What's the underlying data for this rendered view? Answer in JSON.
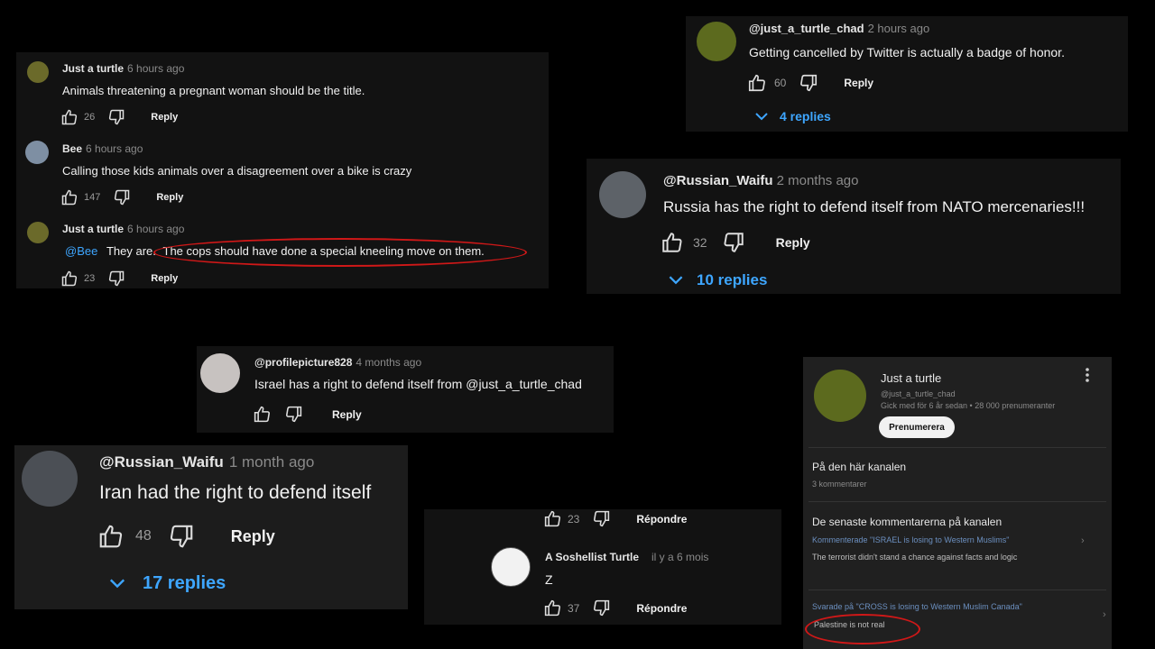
{
  "panel1": {
    "c1": {
      "author": "Just a turtle",
      "time": "6 hours ago",
      "text": "Animals threatening a pregnant woman should be the title.",
      "likes": "26",
      "reply": "Reply"
    },
    "c2": {
      "author": "Bee",
      "time": "6 hours ago",
      "text": "Calling those kids animals over a disagreement over a bike is crazy",
      "likes": "147",
      "reply": "Reply"
    },
    "c3": {
      "author": "Just a turtle",
      "time": "6 hours ago",
      "mention": "@Bee",
      "text_a": "They are.",
      "text_b": "The cops should have done a special kneeling move on them.",
      "likes": "23",
      "reply": "Reply"
    }
  },
  "panel2": {
    "author": "@just_a_turtle_chad",
    "time": "2 hours ago",
    "text": "Getting cancelled by Twitter is actually a badge of honor.",
    "likes": "60",
    "reply": "Reply",
    "replies": "4 replies"
  },
  "panel3": {
    "author": "@Russian_Waifu",
    "time": "2 months ago",
    "text": "Russia has the right to defend itself from NATO mercenaries!!!",
    "likes": "32",
    "reply": "Reply",
    "replies": "10 replies"
  },
  "panel4": {
    "author": "@profilepicture828",
    "time": "4 months ago",
    "text": "Israel has a right to defend itself from @just_a_turtle_chad",
    "reply": "Reply"
  },
  "panel5": {
    "author": "@Russian_Waifu",
    "time": "1 month ago",
    "text": "Iran had the right to defend itself",
    "likes": "48",
    "reply": "Reply",
    "replies": "17 replies"
  },
  "panel6": {
    "top_likes": "23",
    "top_reply": "Répondre",
    "author": "A Soshellist Turtle",
    "time": "il y a 6 mois",
    "text": "Z",
    "likes": "37",
    "reply": "Répondre"
  },
  "panel7": {
    "channel": "Just a turtle",
    "handle": "@just_a_turtle_chad",
    "stats": "Gick med för 6 år sedan • 28 000 prenumeranter",
    "subscribe": "Prenumerera",
    "section1_title": "På den här kanalen",
    "section1_sub": "3 kommentarer",
    "section2_title": "De senaste kommentarerna på kanalen",
    "item1_meta": "Kommenterade \"ISRAEL is losing to Western Muslims\"",
    "item1_text": "The terrorist didn't stand a chance against facts and logic",
    "item2_meta": "Svarade på \"CROSS is losing to Western Muslim Canada\"",
    "item2_text": "Palestine is not real"
  },
  "colors": {
    "background": "#000000",
    "panel": "#121212",
    "link": "#3ea6ff",
    "annotation": "#d01818"
  }
}
